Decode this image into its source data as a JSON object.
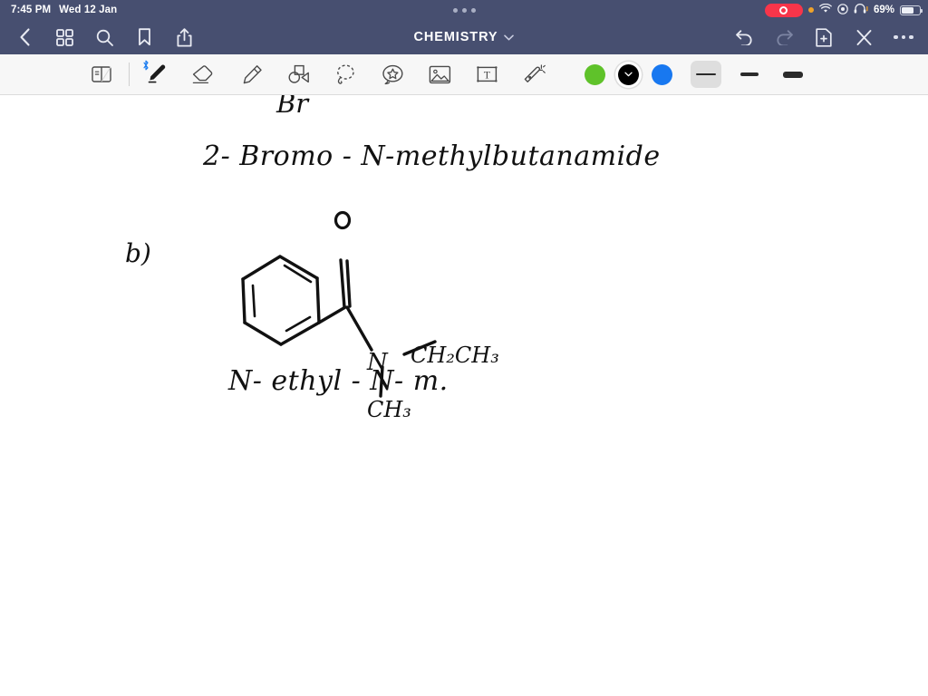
{
  "status_bar": {
    "time": "7:45 PM",
    "date": "Wed 12 Jan",
    "battery_percent": "69%",
    "icons": [
      "record-pill-icon",
      "orange-dot-icon",
      "wifi-icon",
      "control-center-icon",
      "headphones-icon",
      "battery-icon"
    ]
  },
  "nav_bar": {
    "title": "CHEMISTRY",
    "left_icons": [
      "back-chevron-icon",
      "grid-icon",
      "search-icon",
      "bookmark-icon",
      "share-icon"
    ],
    "right_icons": [
      "undo-icon",
      "redo-icon",
      "add-page-icon",
      "close-icon",
      "more-icon"
    ]
  },
  "toolbar": {
    "tools": [
      {
        "name": "page-flip-tool",
        "selected": false
      },
      {
        "name": "pen-tool",
        "selected": true,
        "badge": "bluetooth-icon"
      },
      {
        "name": "eraser-tool",
        "selected": false
      },
      {
        "name": "highlighter-tool",
        "selected": false
      },
      {
        "name": "shapes-tool",
        "selected": false
      },
      {
        "name": "lasso-tool",
        "selected": false
      },
      {
        "name": "sticker-tool",
        "selected": false
      },
      {
        "name": "image-tool",
        "selected": false
      },
      {
        "name": "text-tool",
        "selected": false
      },
      {
        "name": "magic-wand-tool",
        "selected": false
      }
    ],
    "colors": [
      {
        "name": "color-green",
        "hex": "#5fc22a",
        "selected": false
      },
      {
        "name": "color-black",
        "hex": "#000000",
        "selected": true
      },
      {
        "name": "color-blue",
        "hex": "#1878f0",
        "selected": false
      }
    ],
    "stroke_widths": [
      {
        "name": "stroke-thin",
        "selected": true
      },
      {
        "name": "stroke-medium",
        "selected": false
      },
      {
        "name": "stroke-thick",
        "selected": false
      }
    ]
  },
  "canvas": {
    "bromine_label": "Br",
    "compound_name_a": "2- Bromo - N-methylbutanamide",
    "question_label": "b)",
    "compound_name_b": "N- ethyl - N- m.",
    "structure": {
      "oxygen_label": "o",
      "nitrogen_label": "N",
      "ethyl_label": "CH₂CH₃",
      "methyl_label": "CH₃"
    }
  }
}
